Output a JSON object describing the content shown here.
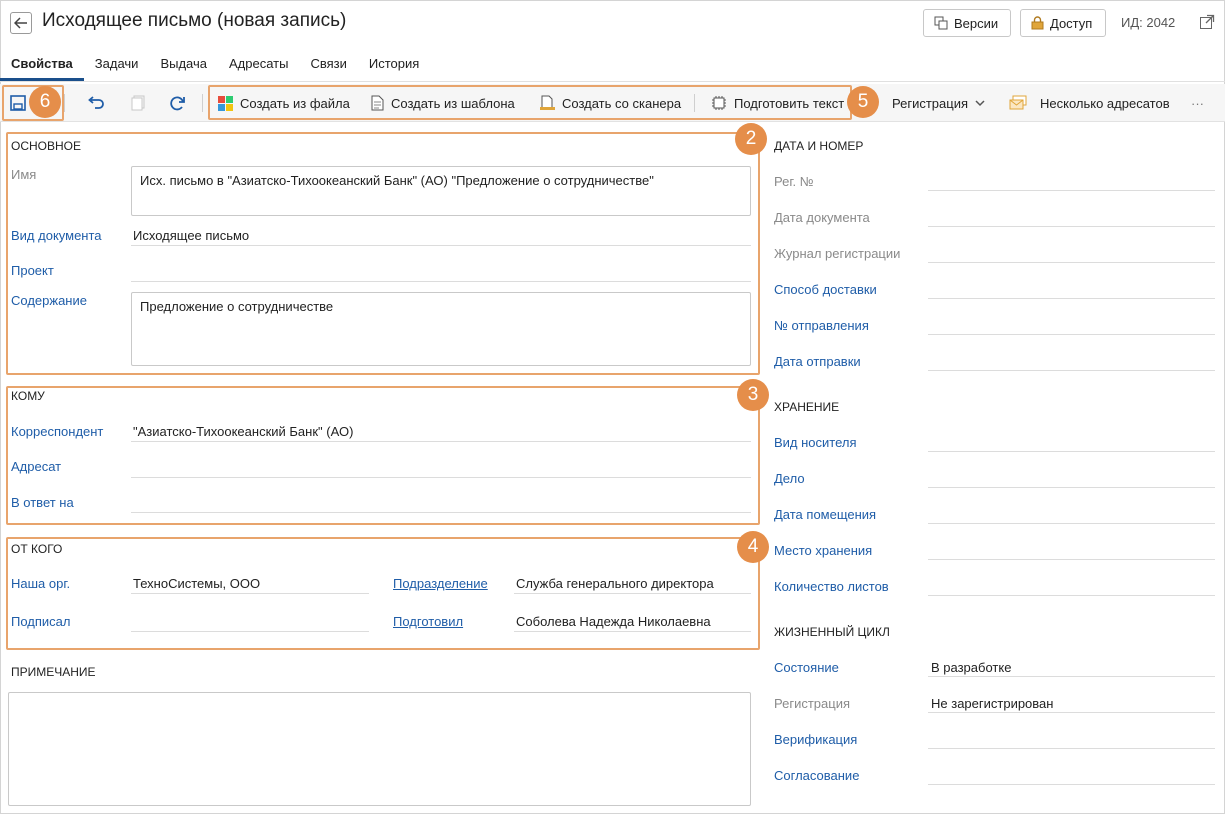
{
  "header": {
    "title": "Исходящее письмо (новая запись)",
    "versions_label": "Версии",
    "access_label": "Доступ",
    "id_text": "ИД: 2042"
  },
  "tabs": [
    {
      "label": "Свойства",
      "active": true
    },
    {
      "label": "Задачи"
    },
    {
      "label": "Выдача"
    },
    {
      "label": "Адресаты"
    },
    {
      "label": "Связи"
    },
    {
      "label": "История"
    }
  ],
  "toolbar": {
    "create_from_file": "Создать из файла",
    "create_from_template": "Создать из шаблона",
    "create_from_scanner": "Создать со сканера",
    "prepare_text": "Подготовить текст",
    "registration": "Регистрация",
    "multiple_recipients": "Несколько адресатов",
    "more": "···"
  },
  "badges": [
    "2",
    "3",
    "4",
    "5",
    "6"
  ],
  "basic": {
    "section": "ОСНОВНОЕ",
    "name_label": "Имя",
    "name_value": "Исх. письмо в \"Азиатско-Тихоокеанский Банк\" (АО) \"Предложение о сотрудничестве\"",
    "doc_type_label": "Вид документа",
    "doc_type_value": "Исходящее письмо",
    "project_label": "Проект",
    "content_label": "Содержание",
    "content_value": "Предложение о сотрудничестве"
  },
  "to": {
    "section": "КОМУ",
    "correspondent_label": "Корреспондент",
    "correspondent_value": "\"Азиатско-Тихоокеанский Банк\" (АО)",
    "addressee_label": "Адресат",
    "reply_to_label": "В ответ на"
  },
  "from": {
    "section": "ОТ КОГО",
    "our_org_label": "Наша орг.",
    "our_org_value": "ТехноСистемы, ООО",
    "department_label": "Подразделение",
    "department_value": "Служба генерального директора",
    "signed_label": "Подписал",
    "prepared_label": "Подготовил",
    "prepared_value": "Соболева Надежда Николаевна"
  },
  "note": {
    "section": "ПРИМЕЧАНИЕ"
  },
  "date_number": {
    "section": "ДАТА И НОМЕР",
    "reg_no": "Рег. №",
    "doc_date": "Дата документа",
    "reg_journal": "Журнал регистрации",
    "delivery_method": "Способ доставки",
    "dispatch_no": "№ отправления",
    "dispatch_date": "Дата отправки"
  },
  "storage": {
    "section": "ХРАНЕНИЕ",
    "media_type": "Вид носителя",
    "case": "Дело",
    "placement_date": "Дата помещения",
    "location": "Место хранения",
    "sheets_count": "Количество листов"
  },
  "lifecycle": {
    "section": "ЖИЗНЕННЫЙ ЦИКЛ",
    "state_label": "Состояние",
    "state_value": "В разработке",
    "registration_label": "Регистрация",
    "registration_value": "Не зарегистрирован",
    "verification_label": "Верификация",
    "approval_label": "Согласование"
  },
  "colors": {
    "accent": "#1f5da8",
    "highlight": "#e8a46c",
    "badge": "#e58e4a"
  }
}
